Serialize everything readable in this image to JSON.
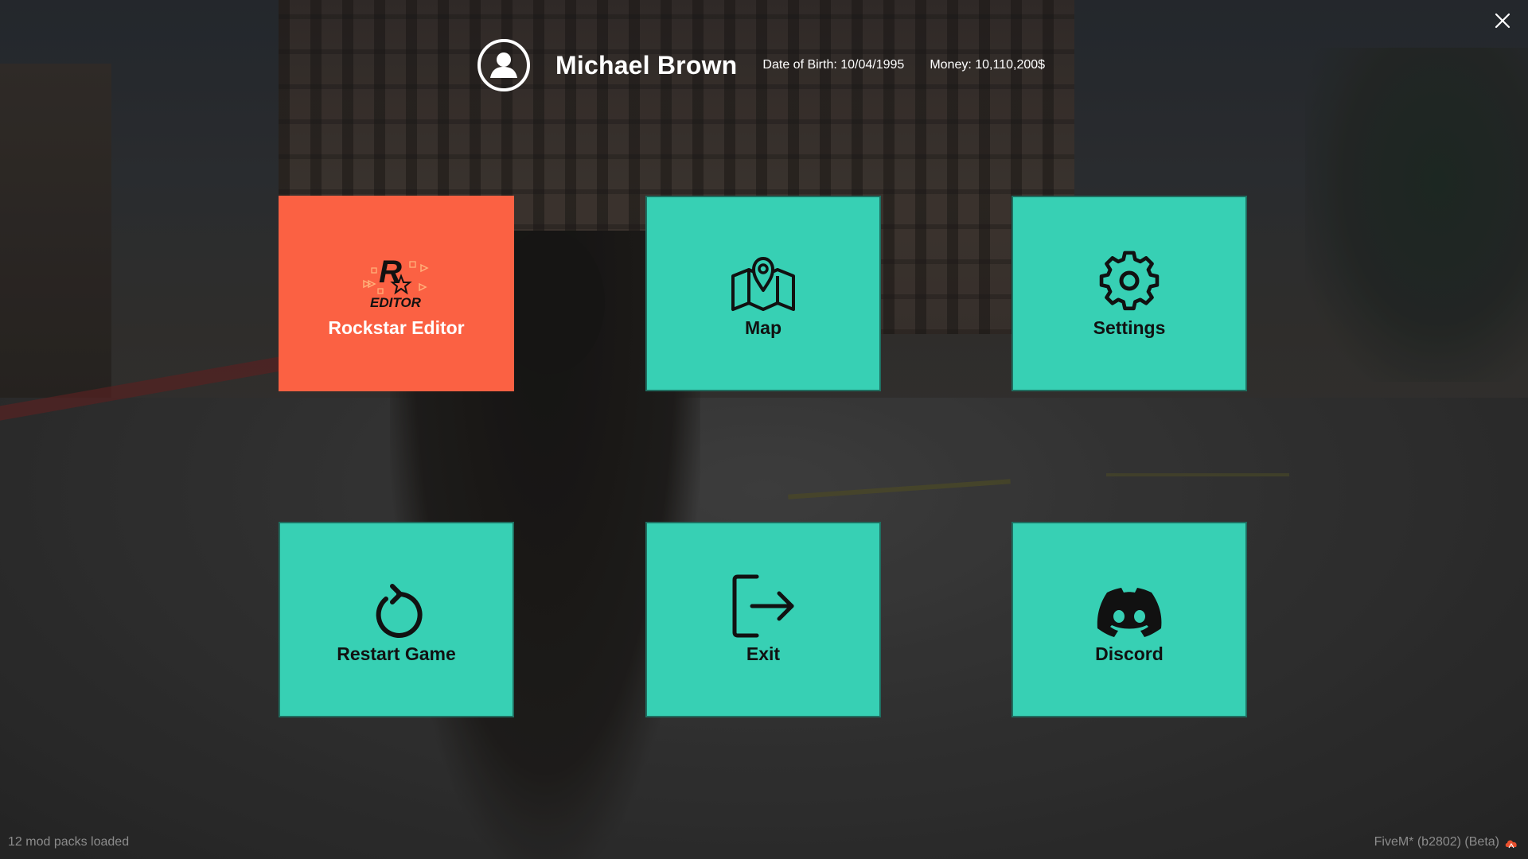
{
  "header": {
    "player_name": "Michael Brown",
    "dob": "Date of Birth: 10/04/1995",
    "money": "Money: 10,110,200$",
    "avatar_icon": "user-circle-icon"
  },
  "close": {
    "icon": "close-icon"
  },
  "tiles": [
    {
      "label": "Rockstar Editor",
      "icon": "rockstar-editor-logo",
      "active": true,
      "color": "#fb6143",
      "logo_letter": "R",
      "logo_text": "EDITOR"
    },
    {
      "label": "Map",
      "icon": "map-icon",
      "active": false,
      "color": "#37d0b4"
    },
    {
      "label": "Settings",
      "icon": "gear-icon",
      "active": false,
      "color": "#37d0b4"
    },
    {
      "label": "Restart Game",
      "icon": "restart-icon",
      "active": false,
      "color": "#37d0b4"
    },
    {
      "label": "Exit",
      "icon": "exit-icon",
      "active": false,
      "color": "#37d0b4"
    },
    {
      "label": "Discord",
      "icon": "discord-icon",
      "active": false,
      "color": "#37d0b4"
    }
  ],
  "footer": {
    "left": "12 mod packs loaded",
    "right": "FiveM* (b2802) (Beta)",
    "right_icon": "cloud-icon"
  },
  "colors": {
    "tile_teal": "#37d0b4",
    "tile_active": "#fb6143",
    "tile_border": "#1f6e60"
  }
}
